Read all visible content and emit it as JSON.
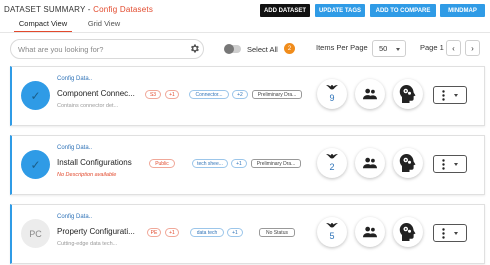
{
  "header": {
    "title_prefix": "DATASET SUMMARY - ",
    "title_accent": "Config Datasets",
    "buttons": {
      "add_dataset": "ADD DATASET",
      "update_tags": "UPDATE TAGS",
      "add_to_compare": "ADD TO COMPARE",
      "mindmap": "MINDMAP"
    }
  },
  "tabs": [
    {
      "label": "Compact View",
      "active": true
    },
    {
      "label": "Grid View",
      "active": false
    }
  ],
  "toolbar": {
    "search_placeholder": "What are you looking for?",
    "select_all_label": "Select All",
    "selected_count": "2",
    "items_per_page_label": "Items Per Page",
    "items_per_page_value": "50",
    "page_label": "Page 1",
    "prev_symbol": "‹",
    "next_symbol": "›"
  },
  "colors": {
    "accent": "#e2492c",
    "primary": "#2f9be6",
    "badge": "#f08c1b"
  },
  "cards": [
    {
      "avatar_text": "✓",
      "breadcrumb": "Config Data..",
      "title": "Component Connec...",
      "description": "Contains connector det...",
      "chips": [
        "S3",
        "+1",
        "Connector...",
        "+2",
        "Preliminary Dra..."
      ],
      "stat": "9",
      "selected": true
    },
    {
      "avatar_text": "✓",
      "breadcrumb": "Config Data..",
      "title": "Install Configurations",
      "description": "No Description available",
      "chips": [
        "Public",
        "tech shee...",
        "+1",
        "Preliminary Dra..."
      ],
      "stat": "2",
      "selected": true
    },
    {
      "avatar_text": "PC",
      "breadcrumb": "Config Data..",
      "title": "Property Configurati...",
      "description": "Cutting-edge data tech...",
      "chips": [
        "PE",
        "+1",
        "data tech",
        "+1",
        "No Status"
      ],
      "stat": "5",
      "selected": false
    }
  ]
}
